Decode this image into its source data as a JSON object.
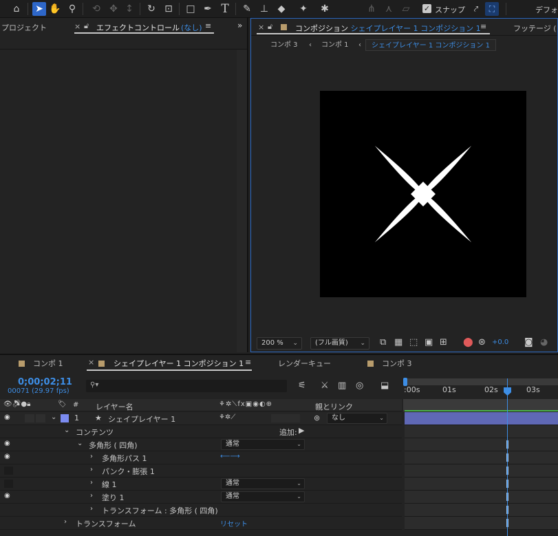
{
  "left_panel": {
    "project_tab": "プロジェクト",
    "effect_tab_label": "エフェクトコントロール",
    "effect_tab_value": "(なし)"
  },
  "comp_panel": {
    "tab_label": "コンポジション",
    "tab_value": "シェイプレイヤー 1 コンポジション 1",
    "footage_tab": "フッテージ (",
    "breadcrumbs": [
      "コンポ 3",
      "コンポ 1",
      "シェイプレイヤー 1 コンポジション 1"
    ],
    "zoom": "200 %",
    "resolution": "(フル画質)",
    "exposure": "+0.0"
  },
  "toolbar": {
    "snap_label": "スナップ",
    "workspace_label": "デフォ"
  },
  "timeline": {
    "tabs": [
      "コンポ 1",
      "シェイプレイヤー 1 コンポジション 1",
      "レンダーキュー",
      "コンポ 3"
    ],
    "timecode": "0;00;02;11",
    "frame_info": "00071 (29.97 fps)",
    "search_placeholder": "",
    "col_header_num": "#",
    "col_header_name": "レイヤー名",
    "col_header_parent": "親とリンク",
    "ruler_labels": [
      ":00s",
      "01s",
      "02s",
      "03s"
    ],
    "layer": {
      "num": "1",
      "name": "シェイプレイヤー 1",
      "parent": "なし"
    },
    "contents": {
      "label": "コンテンツ",
      "add": "追加:"
    },
    "polygon": {
      "label": "多角形 ( 四角)",
      "mode": "通常"
    },
    "path": {
      "label": "多角形パス 1"
    },
    "bulge": {
      "label": "パンク・膨張 1"
    },
    "stroke": {
      "label": "線 1",
      "mode": "通常"
    },
    "fill": {
      "label": "塗り 1",
      "mode": "通常"
    },
    "transform_poly": {
      "label": "トランスフォーム : 多角形 ( 四角)"
    },
    "transform": {
      "label": "トランスフォーム",
      "reset": "リセット"
    }
  },
  "colors": {
    "accent": "#3d8ee6",
    "layer_label": "#7b8bf0",
    "layer_bar": "#5f68b5",
    "tab_swatch": "#b89c6c"
  }
}
